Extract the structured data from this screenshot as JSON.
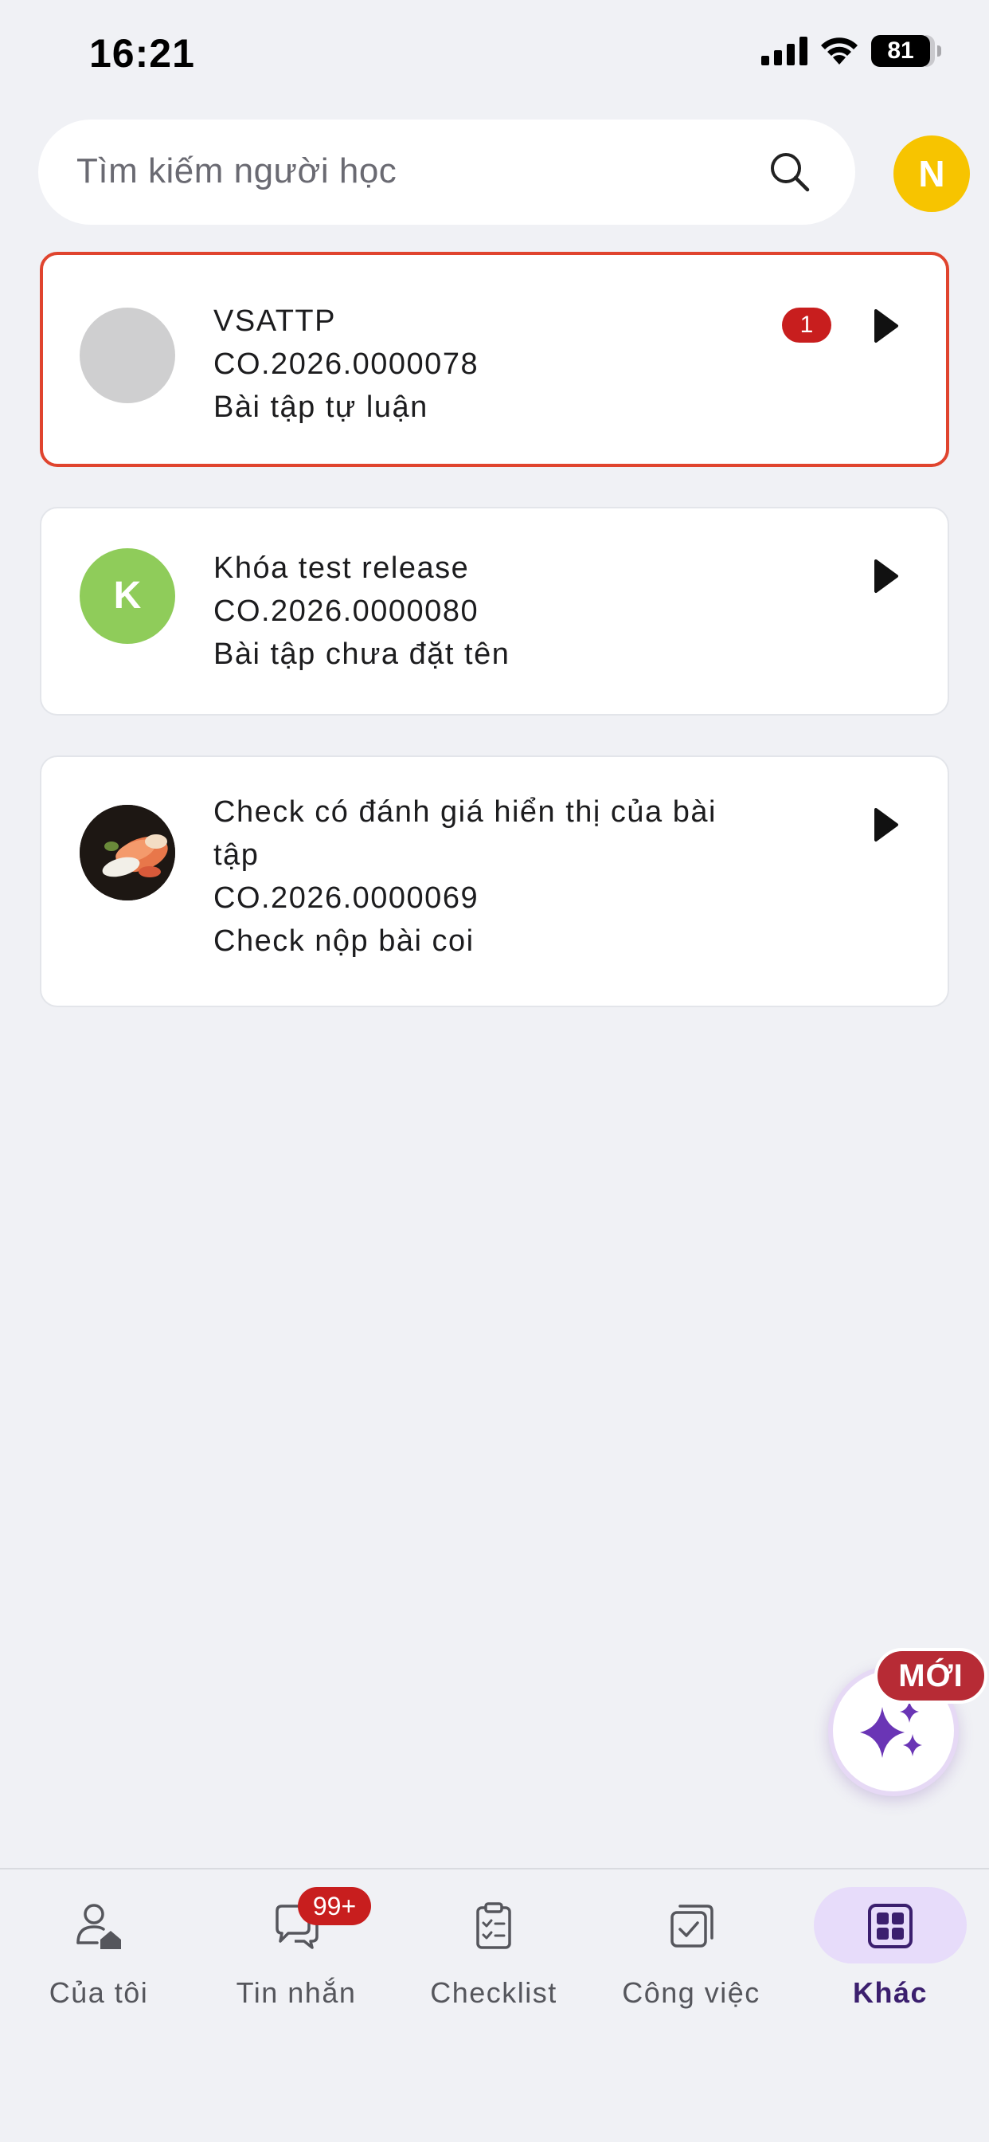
{
  "status_bar": {
    "time": "16:21",
    "battery": "81"
  },
  "search": {
    "placeholder": "Tìm kiếm người học"
  },
  "user_avatar": {
    "initial": "N",
    "color": "#f7c400"
  },
  "courses": [
    {
      "title": "VSATTP",
      "code": "CO.2026.0000078",
      "assignment": "Bài tập tự luận",
      "unread": "1",
      "avatar": "placeholder-grey"
    },
    {
      "title": "Khóa test release",
      "code": "CO.2026.0000080",
      "assignment": "Bài tập chưa đặt tên",
      "avatar_initial": "K",
      "avatar_color": "#8fcc5a"
    },
    {
      "title": "Check có đánh giá hiển thị của bài",
      "title_line2": "tập",
      "code": "CO.2026.0000069",
      "assignment": "Check nộp bài coi",
      "avatar": "food-photo"
    }
  ],
  "fab": {
    "badge": "MỚI",
    "icon": "sparkles-icon"
  },
  "tabs": [
    {
      "label": "Của tôi",
      "icon": "user-home-icon"
    },
    {
      "label": "Tin nhắn",
      "icon": "chat-icon",
      "badge": "99+"
    },
    {
      "label": "Checklist",
      "icon": "clipboard-check-icon"
    },
    {
      "label": "Công việc",
      "icon": "task-stack-icon"
    },
    {
      "label": "Khác",
      "icon": "grid-icon",
      "active": true
    }
  ],
  "colors": {
    "accent": "#3b1f6e",
    "active_tab_bg": "#e7dcfa",
    "badge_red": "#c81e1e",
    "highlight_border": "#e0442e"
  }
}
